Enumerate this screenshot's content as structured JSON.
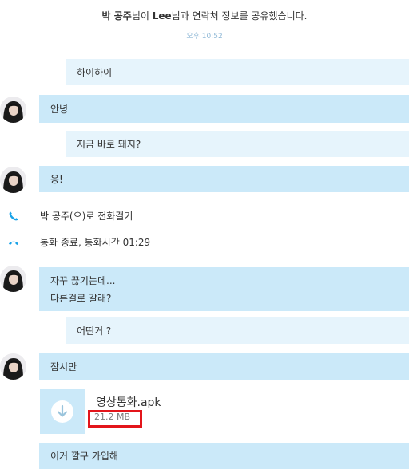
{
  "system": {
    "notice_user": "박 공주",
    "notice_mid": "님이 ",
    "notice_user2": "Lee",
    "notice_tail": "님과 연락처 정보를 공유했습니다.",
    "time": "오후 10:52"
  },
  "messages": {
    "m1": "하이하이",
    "m2": "안녕",
    "m3": "지금 바로 돼지?",
    "m4": "응!",
    "m5_line1": "자꾸 끊기는데...",
    "m5_line2": "다른걸로 갈래?",
    "m6": "어떤거 ?",
    "m7": "잠시만",
    "m8": "이거 깔구 가입해"
  },
  "calls": {
    "call_label": "박 공주(으)로 전화걸기",
    "end_label": "통화 종료, 통화시간 01:29"
  },
  "file": {
    "name": "영상통화.apk",
    "size": "21.2 MB"
  },
  "colors": {
    "bubble_out": "#e6f4fc",
    "bubble_in": "#cbe9f9",
    "call_icon": "#1aa3e8",
    "highlight": "#e3151b"
  },
  "icons": {
    "call": "phone-icon",
    "end_call": "phone-hangup-icon",
    "download": "download-icon"
  }
}
